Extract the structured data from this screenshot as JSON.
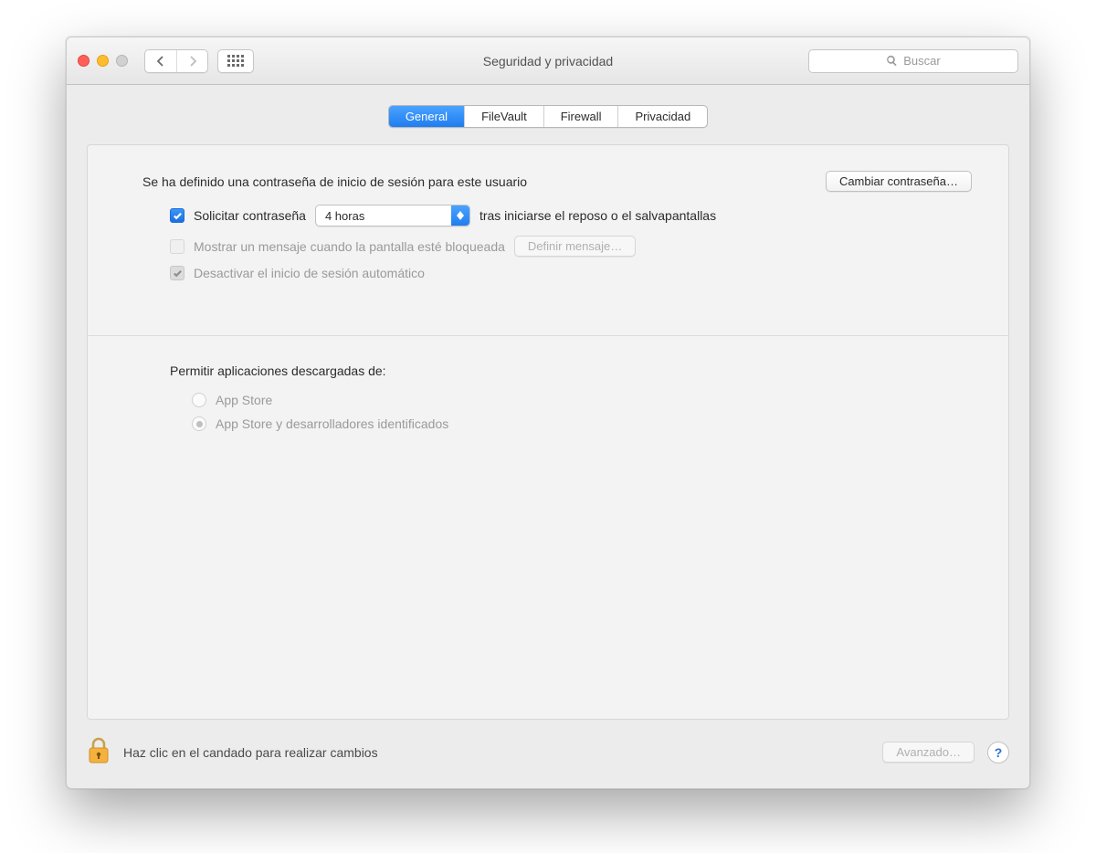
{
  "window": {
    "title": "Seguridad y privacidad",
    "search_placeholder": "Buscar"
  },
  "tabs": {
    "general": "General",
    "filevault": "FileVault",
    "firewall": "Firewall",
    "privacy": "Privacidad"
  },
  "general": {
    "password_defined": "Se ha definido una contraseña de inicio de sesión para este usuario",
    "change_password_btn": "Cambiar contraseña…",
    "require_password_label": "Solicitar contraseña",
    "require_password_delay": "4 horas",
    "require_password_after": "tras iniciarse el reposo o el salvapantallas",
    "show_message_label": "Mostrar un mensaje cuando la pantalla esté bloqueada",
    "set_message_btn": "Definir mensaje…",
    "disable_autologin_label": "Desactivar el inicio de sesión automático",
    "allow_apps_header": "Permitir aplicaciones descargadas de:",
    "radio_appstore": "App Store",
    "radio_identified": "App Store y desarrolladores identificados"
  },
  "footer": {
    "lock_hint": "Haz clic en el candado para realizar cambios",
    "advanced_btn": "Avanzado…",
    "help": "?"
  }
}
